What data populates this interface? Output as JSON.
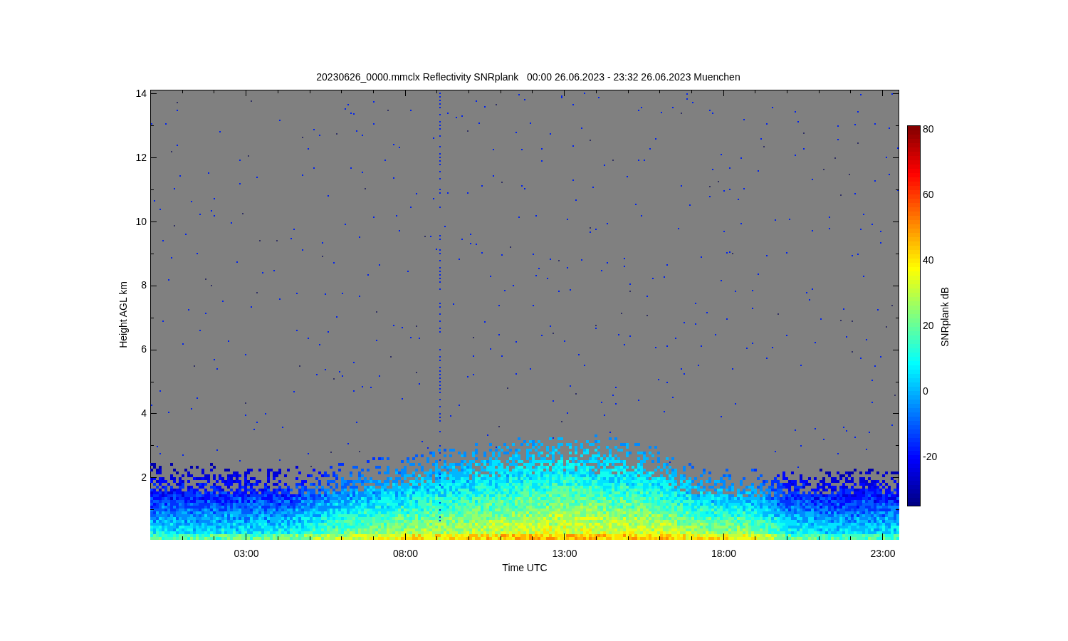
{
  "title": "20230626_0000.mmclx Reflectivity SNRplank   00:00 26.06.2023 - 23:32 26.06.2023 Muenchen",
  "y_axis": {
    "label": "Height AGL km",
    "ticks": [
      "14",
      "12",
      "10",
      "8",
      "6",
      "4",
      "2"
    ]
  },
  "x_axis": {
    "label": "Time UTC",
    "ticks": [
      "03:00",
      "08:00",
      "13:00",
      "18:00",
      "23:00"
    ]
  },
  "colorbar": {
    "label": "SNRplank dB",
    "ticks": [
      "80",
      "60",
      "40",
      "20",
      "0",
      "-20"
    ]
  }
}
